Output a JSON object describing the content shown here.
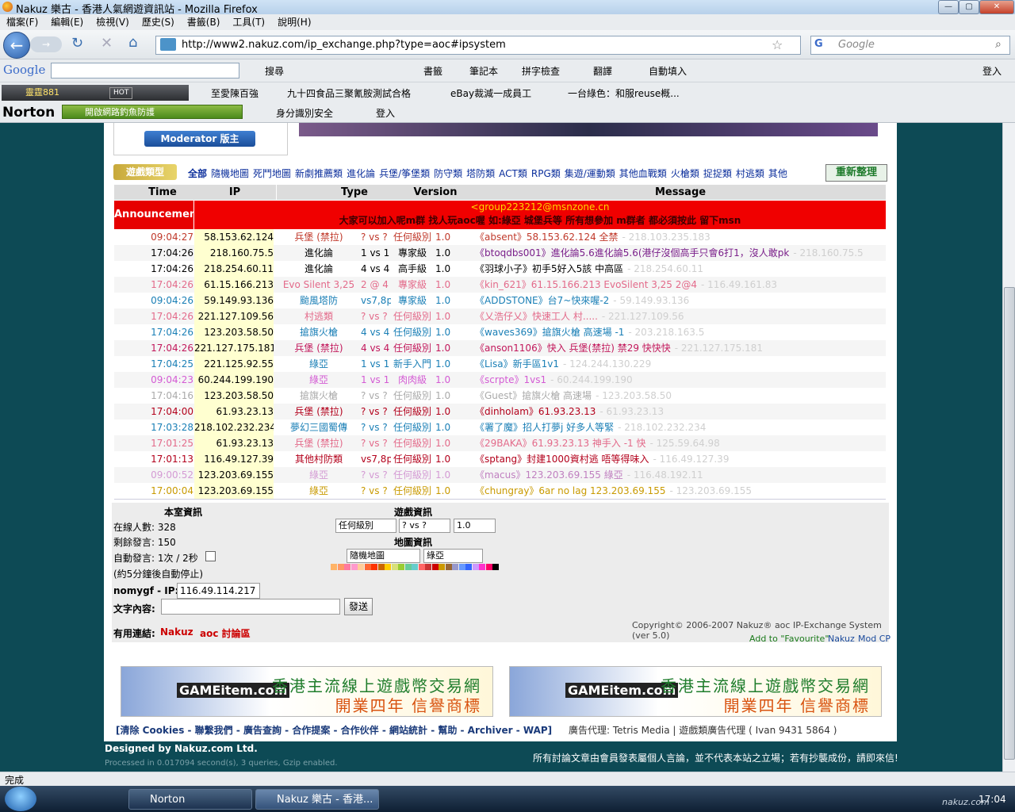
{
  "window": {
    "title": "Nakuz 樂古 - 香港人氣網遊資訊站 - Mozilla Firefox",
    "min": "—",
    "max": "▢",
    "close": "✕"
  },
  "menu": [
    "檔案(F)",
    "編輯(E)",
    "檢視(V)",
    "歷史(S)",
    "書籤(B)",
    "工具(T)",
    "說明(H)"
  ],
  "nav": {
    "url": "http://www2.nakuz.com/ip_exchange.php?type=aoc#ipsystem",
    "search_placeholder": "Google"
  },
  "google_toolbar": {
    "logo": "Google",
    "items": [
      "搜尋",
      "書籤",
      "筆記本",
      "拼字檢查",
      "翻譯",
      "自動填入",
      "登入"
    ]
  },
  "bookmarks": {
    "radio": "靈霆881",
    "radio_badge": "HOT",
    "items": [
      "至愛陳百強",
      "九十四食品三聚氰胺測試合格",
      "eBay裁減一成員工",
      "一台綠色：和服reuse概..."
    ]
  },
  "norton": {
    "logo": "Norton",
    "phishing": "開啟網路釣魚防護",
    "identity": "身分識別安全",
    "login": "登入"
  },
  "page": {
    "moderator_badge": "Moderator 版主",
    "category_label": "遊戲類型",
    "categories": [
      "全部",
      "隨機地圖",
      "死鬥地圖",
      "新劇推薦類",
      "進化論",
      "兵堡/筝堡類",
      "防守類",
      "塔防類",
      "ACT類",
      "RPG類",
      "集遊/運動類",
      "其他血戰類",
      "火槍類",
      "捉捉類",
      "村逃類",
      "其他"
    ],
    "refresh_button": "重新整理",
    "headers": [
      "Time",
      "IP",
      "Type",
      "Version",
      "Message"
    ],
    "announcement_label": "Announcement",
    "announcement_line1": "<group223212@msnzone.cn",
    "announcement_line2": "大家可以加入呢m群 找人玩aoc喔 如:綠亞 城堡兵等 所有想參加 m群者 都必須按此 留下msn",
    "rows": [
      {
        "time": "09:04:27",
        "ip": "58.153.62.124",
        "type": "兵堡 (禁拉)",
        "mode": "? vs ?",
        "level": "任何級別",
        "ver": "1.0",
        "msg": "《absent》58.153.62.124 全禁",
        "fip": "- 218.103.235.183",
        "tc": "#c0392b",
        "mc": "#c0392b"
      },
      {
        "time": "17:04:26",
        "ip": "218.160.75.5",
        "type": "進化論",
        "mode": "1 vs 1",
        "level": "專家級",
        "ver": "1.0",
        "msg": "《btoqdbs001》進化論5.6進化論5.6(港仔沒個高手只會6打1，沒人敢pk",
        "fip": "- 218.160.75.5",
        "tc": "#000000",
        "mc": "#7a1f8a"
      },
      {
        "time": "17:04:26",
        "ip": "218.254.60.11",
        "type": "進化論",
        "mode": "4 vs 4",
        "level": "高手級",
        "ver": "1.0",
        "msg": "《羽球小子》初手5好入5該 中高區",
        "fip": "- 218.254.60.11",
        "tc": "#000000",
        "mc": "#000000"
      },
      {
        "time": "17:04:26",
        "ip": "61.15.166.213",
        "type": "Evo Silent 3,25",
        "mode": "2 @ 4",
        "level": "專家級",
        "ver": "1.0",
        "msg": "《kin_621》61.15.166.213 EvoSilent 3,25 2@4",
        "fip": "- 116.49.161.83",
        "tc": "#e36a8a",
        "mc": "#e36a8a"
      },
      {
        "time": "09:04:26",
        "ip": "59.149.93.136",
        "type": "颱風塔防",
        "mode": "vs7,8p",
        "level": "專家級",
        "ver": "1.0",
        "msg": "《ADDSTONE》台7~快來喔-2",
        "fip": "- 59.149.93.136",
        "tc": "#1a7fb6",
        "mc": "#1a7fb6"
      },
      {
        "time": "17:04:26",
        "ip": "221.127.109.56",
        "type": "村逃類",
        "mode": "? vs ?",
        "level": "任何級別",
        "ver": "1.0",
        "msg": "《乂浩仔乂》快速工人 村.....",
        "fip": "- 221.127.109.56",
        "tc": "#e36a8a",
        "mc": "#e36a8a"
      },
      {
        "time": "17:04:26",
        "ip": "123.203.58.50",
        "type": "搶旗火槍",
        "mode": "4 vs 4",
        "level": "任何級別",
        "ver": "1.0",
        "msg": "《waves369》搶旗火槍 高速場 -1",
        "fip": "- 203.218.163.5",
        "tc": "#1a7fb6",
        "mc": "#1a7fb6"
      },
      {
        "time": "17:04:26",
        "ip": "221.127.175.181",
        "type": "兵堡 (禁拉)",
        "mode": "4 vs 4",
        "level": "任何級別",
        "ver": "1.0",
        "msg": "《anson1106》快入 兵堡(禁拉) 禁29 快快快",
        "fip": "- 221.127.175.181",
        "tc": "#c2185b",
        "mc": "#c2185b"
      },
      {
        "time": "17:04:25",
        "ip": "221.125.92.55",
        "type": "綠亞",
        "mode": "1 vs 1",
        "level": "新手入門",
        "ver": "1.0",
        "msg": "《Lisa》新手區1v1",
        "fip": "- 124.244.130.229",
        "tc": "#1a7fb6",
        "mc": "#1a7fb6"
      },
      {
        "time": "09:04:23",
        "ip": "60.244.199.190",
        "type": "綠亞",
        "mode": "1 vs 1",
        "level": "肉肉級",
        "ver": "1.0",
        "msg": "《scrpte》1vs1",
        "fip": "- 60.244.199.190",
        "tc": "#d45bd4",
        "mc": "#d45bd4"
      },
      {
        "time": "17:04:16",
        "ip": "123.203.58.50",
        "type": "搶旗火槍",
        "mode": "? vs ?",
        "level": "任何級別",
        "ver": "1.0",
        "msg": "《Guest》搶旗火槍 高速場",
        "fip": "- 123.203.58.50",
        "tc": "#aaaaaa",
        "mc": "#aaaaaa"
      },
      {
        "time": "17:04:00",
        "ip": "61.93.23.13",
        "type": "兵堡 (禁拉)",
        "mode": "? vs ?",
        "level": "任何級別",
        "ver": "1.0",
        "msg": "《dinholam》61.93.23.13",
        "fip": "- 61.93.23.13",
        "tc": "#b3001b",
        "mc": "#b3001b"
      },
      {
        "time": "17:03:28",
        "ip": "218.102.232.234",
        "type": "夢幻三國蜀傳",
        "mode": "? vs ?",
        "level": "任何級別",
        "ver": "1.0",
        "msg": "《署了魔》招人打夢j 好多人等緊",
        "fip": "- 218.102.232.234",
        "tc": "#1a7fb6",
        "mc": "#1a7fb6"
      },
      {
        "time": "17:01:25",
        "ip": "61.93.23.13",
        "type": "兵堡 (禁拉)",
        "mode": "? vs ?",
        "level": "任何級別",
        "ver": "1.0",
        "msg": "《29BAKA》61.93.23.13 神手入 -1 快",
        "fip": "- 125.59.64.98",
        "tc": "#e36a8a",
        "mc": "#e36a8a"
      },
      {
        "time": "17:01:13",
        "ip": "116.49.127.39",
        "type": "其他村防類",
        "mode": "vs7,8p",
        "level": "任何級別",
        "ver": "1.0",
        "msg": "《sptang》封建1000資村逃 唔等得味入",
        "fip": "- 116.49.127.39",
        "tc": "#b3001b",
        "mc": "#b3001b"
      },
      {
        "time": "09:00:52",
        "ip": "123.203.69.155",
        "type": "綠亞",
        "mode": "? vs ?",
        "level": "任何級別",
        "ver": "1.0",
        "msg": "《macus》123.203.69.155 綠亞",
        "fip": "- 116.48.192.11",
        "tc": "#d49bd4",
        "mc": "#c080c0"
      },
      {
        "time": "17:00:04",
        "ip": "123.203.69.155",
        "type": "綠亞",
        "mode": "? vs ?",
        "level": "任何級別",
        "ver": "1.0",
        "msg": "《chungray》6ar no lag 123.203.69.155",
        "fip": "- 123.203.69.155",
        "tc": "#c99a00",
        "mc": "#c99a00"
      }
    ],
    "room": {
      "title": "本室資訊",
      "online": "在線人數: 328",
      "remaining": "剩餘發言: 150",
      "auto": "自動發言: 1次 / 2秒",
      "auto_note": "(約5分鐘後自動停止)",
      "ip_label": "nomygf - IP:",
      "ip_value": "116.49.114.217",
      "text_label": "文字內容:",
      "send": "發送",
      "links_label": "有用連結:",
      "link1": "Nakuz",
      "link2": "aoc 討論區"
    },
    "game": {
      "title": "遊戲資訊",
      "level_select": "任何級別",
      "mode_select": "? vs ?",
      "ver_select": "1.0",
      "map_title": "地圖資訊",
      "map_select": "隨機地圖",
      "type_select": "綠亞"
    },
    "copyright": "Copyright© 2006-2007  Nakuz® aoc IP-Exchange System (ver 5.0)",
    "fav": "Add to \"Favourite\"",
    "fav_nakuz": "Nakuz",
    "fav_mod": "Mod CP",
    "ad_line1": "香港主流線上遊戲幣交易網",
    "ad_line2": "開業四年 信譽商標",
    "ad_logo": "GAMEitem.com",
    "bottom_links": "[清除 Cookies - 聯繫我們 - 廣告查詢 - 合作提案 - 合作伙伴 - 網站統計 - 幫助 - Archiver - WAP]",
    "ad_agent": "廣告代理: Tetris Media | 遊戲類廣告代理 ( Ivan 9431 5864 )",
    "designed": "Designed by Nakuz.com Ltd.",
    "processed": "Processed in 0.017094 second(s), 3 queries, Gzip enabled.",
    "disclaimer": "所有討論文章由會員發表屬個人言論，並不代表本站之立場；若有抄襲成份，請即來信!"
  },
  "status": "完成",
  "taskbar": {
    "btn1": "Norton",
    "btn2": "Nakuz 樂古 - 香港...",
    "clock": "17:04",
    "watermark": "nakuz.com"
  },
  "palette": [
    "#ffb366",
    "#ff9966",
    "#ff7aa0",
    "#ff99cc",
    "#ffcc99",
    "#ff6633",
    "#ff3300",
    "#cc6600",
    "#ffcc00",
    "#d8e07a",
    "#99cc33",
    "#66cc99",
    "#66cccc",
    "#ff6666",
    "#cc3333",
    "#cc0000",
    "#cc9900",
    "#996633",
    "#9999cc",
    "#6699ff",
    "#3366ff",
    "#cc99ff",
    "#ff33cc",
    "#ff0066",
    "#000000"
  ]
}
